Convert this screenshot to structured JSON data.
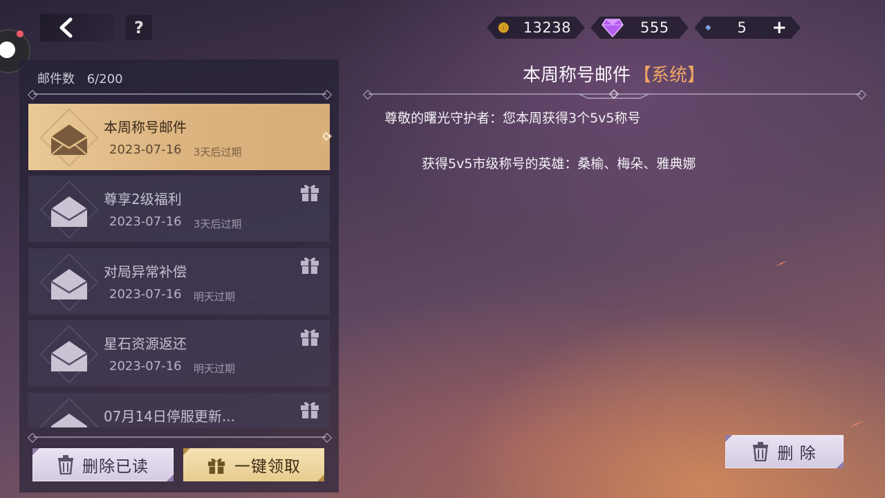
{
  "header": {
    "back_icon": "chevron-left-icon",
    "help_label": "?"
  },
  "currencies": [
    {
      "icon": "gold-coin-icon",
      "value": "13238"
    },
    {
      "icon": "purple-diamond-icon",
      "value": "555"
    },
    {
      "icon": "blue-crystal-icon",
      "value": "5",
      "add_label": "+"
    }
  ],
  "mailbox": {
    "count_label": "邮件数",
    "count_value": "6/200",
    "items": [
      {
        "title": "本周称号邮件",
        "date": "2023-07-16",
        "expire": "3天后过期",
        "selected": true,
        "has_gift": false
      },
      {
        "title": "尊享2级福利",
        "date": "2023-07-16",
        "expire": "3天后过期",
        "selected": false,
        "has_gift": true
      },
      {
        "title": "对局异常补偿",
        "date": "2023-07-16",
        "expire": "明天过期",
        "selected": false,
        "has_gift": true
      },
      {
        "title": "星石资源返还",
        "date": "2023-07-16",
        "expire": "明天过期",
        "selected": false,
        "has_gift": true
      },
      {
        "title": "07月14日停服更新...",
        "date": "",
        "expire": "",
        "selected": false,
        "has_gift": true
      }
    ],
    "delete_read_label": "删除已读",
    "claim_all_label": "一键领取"
  },
  "detail": {
    "title": "本周称号邮件",
    "tag": "【系统】",
    "body_line1": "尊敬的曙光守护者：您本周获得3个5v5称号",
    "body_line2": "获得5v5市级称号的英雄：桑榆、梅朵、雅典娜",
    "delete_label": "删 除"
  },
  "colors": {
    "selected_item": "#dcb480",
    "tag_orange": "#f0a565",
    "accent_purple": "#8e7aa8"
  }
}
